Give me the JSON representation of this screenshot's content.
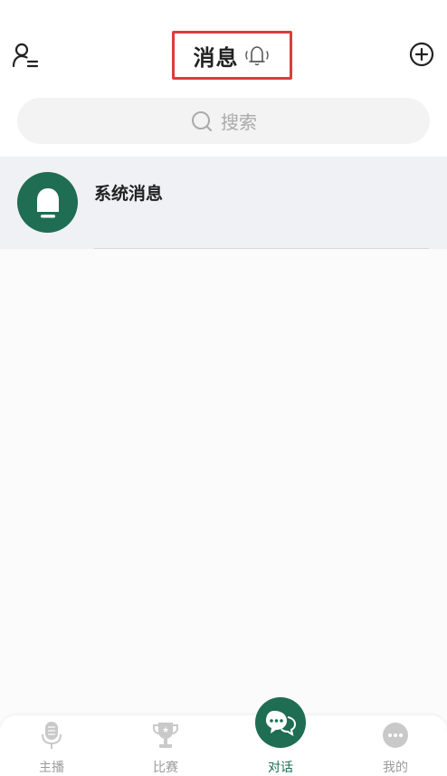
{
  "header": {
    "title": "消息",
    "contacts_icon": "user-list-icon",
    "bell_icon": "bell-icon",
    "add_icon": "plus-circle-icon"
  },
  "search": {
    "placeholder": "搜索",
    "icon": "search-icon"
  },
  "messages": [
    {
      "title": "系统消息",
      "icon": "bell-icon",
      "color": "#1f6d52"
    }
  ],
  "tabbar": {
    "items": [
      {
        "label": "主播",
        "icon": "microphone-icon",
        "active": false
      },
      {
        "label": "比赛",
        "icon": "trophy-icon",
        "active": false
      },
      {
        "label": "对话",
        "icon": "chat-icon",
        "active": true
      },
      {
        "label": "我的",
        "icon": "more-icon",
        "active": false
      }
    ]
  },
  "colors": {
    "accent": "#1f6d52",
    "highlight_border": "#e03a3a",
    "text": "#222222",
    "muted": "#9b9b9b"
  }
}
